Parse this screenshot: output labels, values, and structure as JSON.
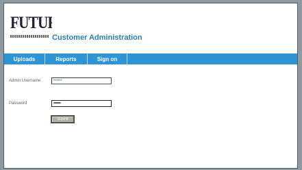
{
  "header": {
    "logo_text": "FUTURES",
    "title": "Customer Administration"
  },
  "nav": {
    "items": [
      {
        "label": "Uploads"
      },
      {
        "label": "Reports"
      },
      {
        "label": "Sign on"
      }
    ]
  },
  "form": {
    "username_label": "Admin Username",
    "username_value": "••••••",
    "password_label": "Password",
    "password_value": "•••••••••",
    "submit_label": "Submit"
  },
  "colors": {
    "nav_background": "#2e94d4",
    "title": "#2c7ea8",
    "page_background": "#ffffff",
    "desktop_background": "#8d9aa3"
  }
}
